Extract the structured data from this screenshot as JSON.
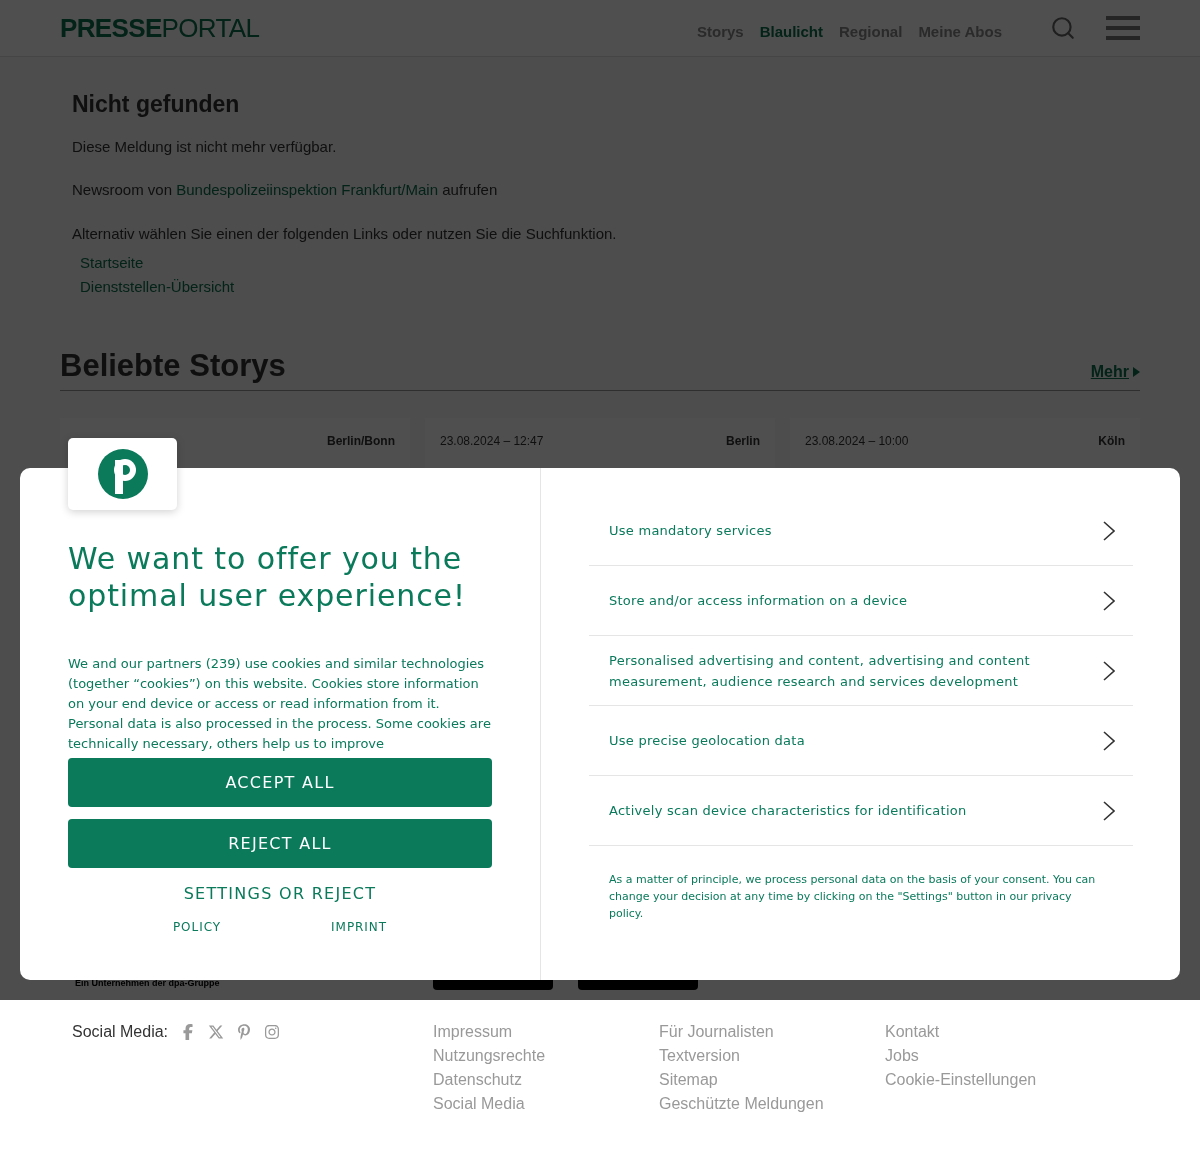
{
  "header": {
    "logo": {
      "bold": "PRESSE",
      "light": "PORTAL"
    },
    "nav": [
      {
        "label": "Storys",
        "selected": false
      },
      {
        "label": "Blaulicht",
        "selected": true
      },
      {
        "label": "Regional",
        "selected": false
      },
      {
        "label": "Meine Abos",
        "selected": false
      }
    ]
  },
  "notice": {
    "title": "Nicht gefunden",
    "message": "Diese Meldung ist nicht mehr verfügbar.",
    "newsroom": {
      "prefix": "Newsroom von",
      "link": "Bundespolizeiinspektion Frankfurt/Main",
      "suffix": "aufrufen"
    },
    "alternative": "Alternativ wählen Sie einen der folgenden Links oder nutzen Sie die Suchfunktion.",
    "links": [
      "Startseite",
      "Dienststellen-Übersicht"
    ]
  },
  "popular": {
    "title": "Beliebte Storys",
    "more": "Mehr",
    "cards": [
      {
        "place": "Berlin/Bonn"
      },
      {
        "date": "23.08.2024 – 12:47",
        "place": "Berlin"
      },
      {
        "date": "23.08.2024 – 10:00",
        "place": "Köln"
      }
    ]
  },
  "company_note": "Ein Unternehmen der dpa-Gruppe",
  "consent": {
    "headline": "We want to offer you the optimal user experience!",
    "paragraphs": [
      "We and our partners (239) use cookies and similar technologies (together “cookies”) on this website. Cookies store information on your end device or access or read information from it.",
      "Personal data is also processed in the process. Some cookies are technically necessary, others help us to improve"
    ],
    "accept": "ACCEPT ALL",
    "reject": "REJECT ALL",
    "settings": "SETTINGS OR REJECT",
    "links": [
      "POLICY",
      "IMPRINT"
    ],
    "purposes": [
      "Use mandatory services",
      "Store and/or access information on a device",
      "Personalised advertising and content, advertising and content measurement, audience research and services development",
      "Use precise geolocation data",
      "Actively scan device characteristics for identification"
    ],
    "note": "As a matter of principle, we process personal data on the basis of your consent. You can change your decision at any time by clicking on the \"Settings\" button in our privacy policy."
  },
  "footer": {
    "social_label": "Social Media:",
    "columns": [
      [
        "Impressum",
        "Nutzungsrechte",
        "Datenschutz",
        "Social Media"
      ],
      [
        "Für Journalisten",
        "Textversion",
        "Sitemap",
        "Geschützte Meldungen"
      ],
      [
        "Kontakt",
        "Jobs",
        "Cookie-Einstellungen"
      ]
    ]
  }
}
